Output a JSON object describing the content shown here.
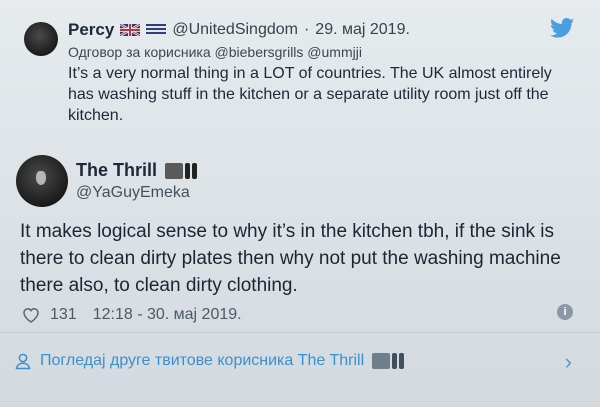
{
  "reply_tweet": {
    "display_name": "Percy",
    "handle": "@UnitedSingdom",
    "separator": "·",
    "date": "29. мај 2019.",
    "replying_to": "Одговор за корисника @biebersgrills @ummjji",
    "text": "It’s a very normal thing in a LOT of countries. The UK almost entirely has washing stuff in the kitchen or a separate utility room just off the kitchen."
  },
  "main_tweet": {
    "display_name": "The Thrill",
    "handle": "@YaGuyEmeka",
    "text": "It makes logical sense to why it’s in the kitchen tbh, if the sink is there to clean dirty plates then why not put the washing machine there also, to clean dirty clothing.",
    "likes": "131",
    "timestamp": "12:18 - 30. мај 2019."
  },
  "footer": {
    "more_link": "Погледај друге твитове корисника The Thrill"
  },
  "icons": {
    "brand": "twitter-bird-icon",
    "like": "heart-icon",
    "info": "info-icon",
    "person": "person-icon",
    "chevron": "chevron-right-icon"
  },
  "colors": {
    "link": "#3b8fd1",
    "twitter_blue": "#4a9fe0",
    "text": "#1c2938"
  }
}
